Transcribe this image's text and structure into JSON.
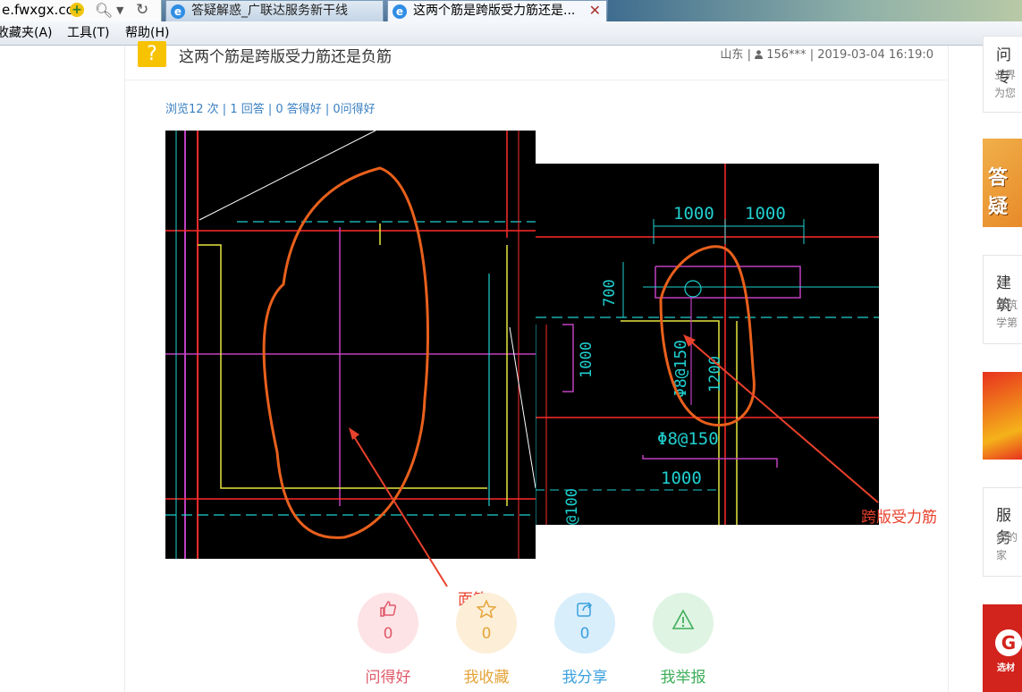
{
  "browser": {
    "url": "e.fwxgx.cc",
    "tabs": [
      {
        "title": "答疑解惑_广联达服务新干线"
      },
      {
        "title": "这两个筋是跨版受力筋还是..."
      }
    ],
    "menu": [
      "收藏夹(A)",
      "工具(T)",
      "帮助(H)"
    ]
  },
  "question": {
    "title": "这两个筋是跨版受力筋还是负筋",
    "region": "山东",
    "user": "156***",
    "datetime": "2019-03-04 16:19:0",
    "stats": "浏览12 次 | 1 回答 | 0 答得好 | 0问得好"
  },
  "drawing": {
    "dims_top": [
      "1000",
      "1000"
    ],
    "dim_700": "700",
    "dim_1000v": "1000",
    "rebar_v": "Φ8@150",
    "dim_1200": "1200",
    "rebar_h": "Φ8@150",
    "dim_1000b": "1000",
    "bottom_tag": "@100",
    "label_top_rebar": "面筋",
    "label_span_rebar": "跨版受力筋"
  },
  "actions": [
    {
      "label": "问得好",
      "count": "0",
      "icon": "thumbs-up-icon",
      "color": "#e05a6a",
      "bg": "#fde3e6"
    },
    {
      "label": "我收藏",
      "count": "0",
      "icon": "star-icon",
      "color": "#e5a43a",
      "bg": "#fdefd7"
    },
    {
      "label": "我分享",
      "count": "0",
      "icon": "share-icon",
      "color": "#3aa0df",
      "bg": "#d9eefb"
    },
    {
      "label": "我举报",
      "count": "0",
      "icon": "warning-icon",
      "color": "#3fae5a",
      "bg": "#dff4e3"
    }
  ],
  "sidebar": {
    "box1_title": "问专",
    "box1_text": [
      "业界",
      "为您"
    ],
    "box2_title": "建筑",
    "box2_text": [
      "建筑",
      "学第"
    ],
    "box3_title": "服务",
    "box3_text": [
      "您的",
      "家"
    ],
    "banner_text": "答疑",
    "brand_text": "选材"
  }
}
